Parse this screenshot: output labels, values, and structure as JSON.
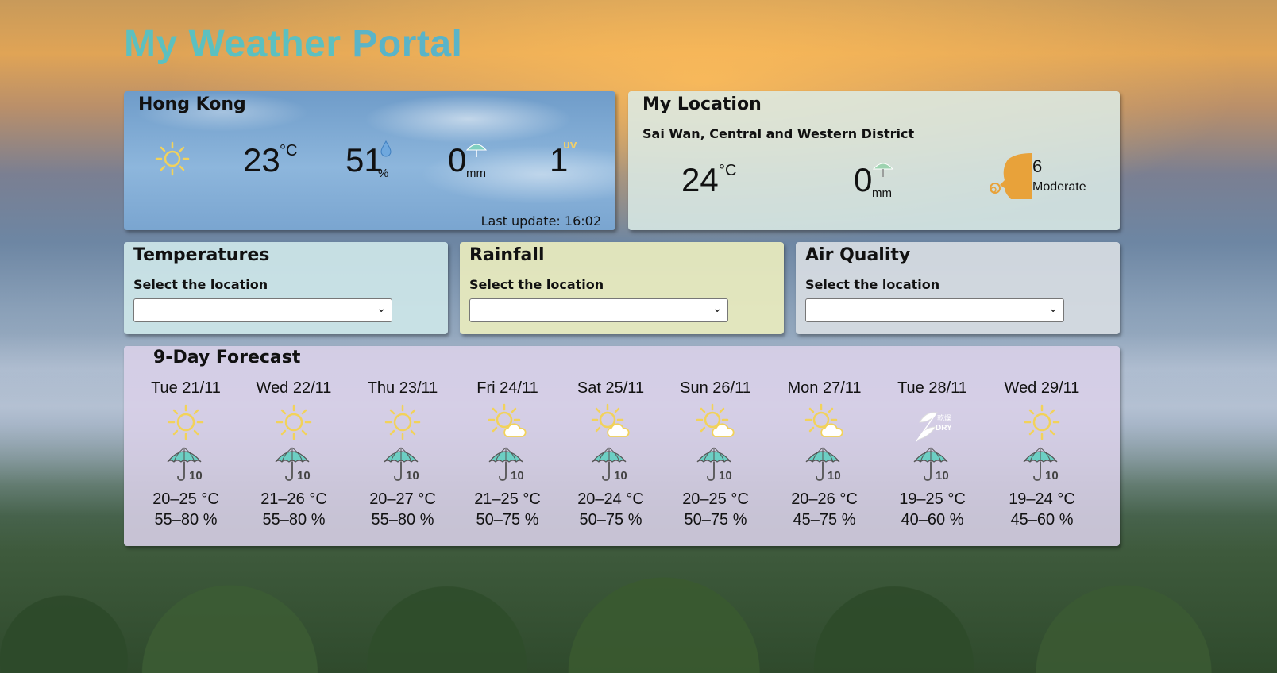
{
  "page": {
    "title_part1": "My Weather ",
    "title_part2": "Portal",
    "title_color": "#5cc0c0"
  },
  "hong_kong": {
    "title": "Hong Kong",
    "weather_icon": "sunny-icon",
    "temperature": "23",
    "temperature_unit": "°C",
    "humidity": "51",
    "humidity_unit": "%",
    "rainfall": "0",
    "rainfall_unit": "mm",
    "uv_index": "1",
    "uv_label": "UV",
    "last_update": "Last update: 16:02"
  },
  "my_location": {
    "title": "My Location",
    "location_name": "Sai Wan, Central and Western District",
    "temperature": "24",
    "temperature_unit": "°C",
    "rainfall": "0",
    "rainfall_unit": "mm",
    "aqhi_value": "6",
    "aqhi_level": "Moderate",
    "aqhi_color": "#e8a23a"
  },
  "temperatures": {
    "title": "Temperatures",
    "label": "Select the location",
    "selected": ""
  },
  "rainfall": {
    "title": "Rainfall",
    "label": "Select the location",
    "selected": ""
  },
  "air_quality": {
    "title": "Air Quality",
    "label": "Select the location",
    "selected": ""
  },
  "forecast": {
    "title": "9-Day Forecast",
    "days": [
      {
        "date": "Tue 21/11",
        "icon": "sunny-icon",
        "psr": "10",
        "temp": "20–25 °C",
        "humidity": "55–80 %"
      },
      {
        "date": "Wed 22/11",
        "icon": "sunny-icon",
        "psr": "10",
        "temp": "21–26 °C",
        "humidity": "55–80 %"
      },
      {
        "date": "Thu 23/11",
        "icon": "sunny-icon",
        "psr": "10",
        "temp": "20–27 °C",
        "humidity": "55–80 %"
      },
      {
        "date": "Fri 24/11",
        "icon": "sunny-periods-icon",
        "psr": "10",
        "temp": "21–25 °C",
        "humidity": "50–75 %"
      },
      {
        "date": "Sat 25/11",
        "icon": "sunny-periods-icon",
        "psr": "10",
        "temp": "20–24 °C",
        "humidity": "50–75 %"
      },
      {
        "date": "Sun 26/11",
        "icon": "sunny-periods-icon",
        "psr": "10",
        "temp": "20–25 °C",
        "humidity": "50–75 %"
      },
      {
        "date": "Mon 27/11",
        "icon": "sunny-periods-icon",
        "psr": "10",
        "temp": "20–26 °C",
        "humidity": "45–75 %"
      },
      {
        "date": "Tue 28/11",
        "icon": "dry-icon",
        "psr": "10",
        "temp": "19–25 °C",
        "humidity": "40–60 %"
      },
      {
        "date": "Wed 29/11",
        "icon": "sunny-icon",
        "psr": "10",
        "temp": "19–24 °C",
        "humidity": "45–60 %"
      }
    ]
  },
  "colors": {
    "umbrella_teal": "#6ccfc4",
    "sun_yellow": "#f2d25a"
  }
}
